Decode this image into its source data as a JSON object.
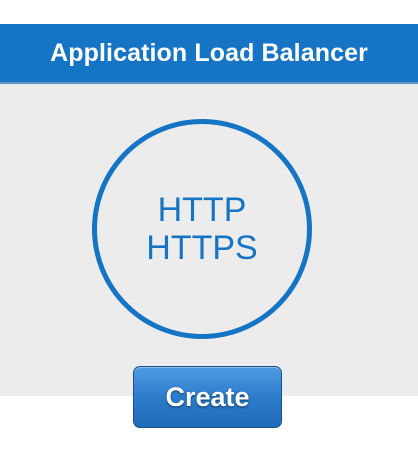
{
  "panel": {
    "title": "Application Load Balancer",
    "protocols": [
      "HTTP",
      "HTTPS"
    ]
  },
  "actions": {
    "create_label": "Create"
  },
  "colors": {
    "accent": "#1674c4",
    "panel_background": "#ececec",
    "page_background": "#ffffff"
  }
}
